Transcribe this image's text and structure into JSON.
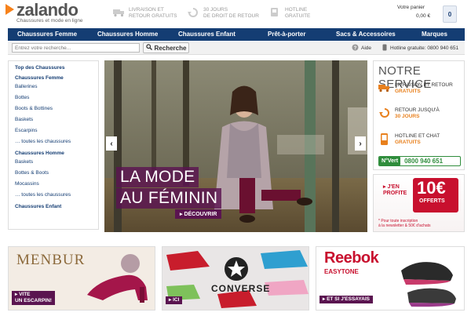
{
  "header": {
    "logo_word": "zalando",
    "logo_tagline": "Chaussures et mode en ligne",
    "usps": [
      {
        "icon": "truck-icon",
        "text_1": "LIVRAISON ET",
        "text_2": "RETOUR GRATUITS"
      },
      {
        "icon": "return-arrow-icon",
        "text_1": "30 JOURS",
        "text_2": "DE DROIT DE RETOUR"
      },
      {
        "icon": "phone-icon",
        "text_1": "HOTLINE",
        "text_2": "GRATUITE"
      }
    ],
    "cart": {
      "label": "Votre panier",
      "amount": "0,00 €",
      "count": "0"
    }
  },
  "nav": {
    "items": [
      "Chaussures Femme",
      "Chaussures Homme",
      "Chaussures Enfant",
      "Prêt-à-porter",
      "Sacs & Accessoires",
      "Marques"
    ]
  },
  "search": {
    "placeholder": "Entrez votre recherche...",
    "button": "Recherche",
    "help": "Aide",
    "hotline": "Hotline gratuite: 0800 940 651"
  },
  "sidebar": {
    "heading": "Top des Chaussures",
    "groups": [
      {
        "title": "Chaussures Femme",
        "links": [
          "Ballerines",
          "Bottes",
          "Boots & Bottines",
          "Baskets",
          "Escarpins",
          "… toutes les chaussures"
        ]
      },
      {
        "title": "Chaussures Homme",
        "links": [
          "Baskets",
          "Bottes & Boots",
          "Mocassins",
          "… toutes les chaussures"
        ]
      },
      {
        "title": "Chaussures Enfant",
        "links": []
      }
    ]
  },
  "hero": {
    "title_1": "LA MODE",
    "title_2": "AU FÉMININ",
    "cta": "▸ DÉCOUVRIR"
  },
  "service": {
    "title": "NOTRE SERVICE",
    "rows": [
      {
        "icon": "truck-icon",
        "text": "LIVRAISON ET RETOUR",
        "highlight": "GRATUITS"
      },
      {
        "icon": "return-arrow-icon",
        "text": "RETOUR JUSQU'À",
        "highlight": "30 JOURS"
      },
      {
        "icon": "mobile-phone-icon",
        "text": "HOTLINE ET CHAT",
        "highlight": "GRATUITS"
      }
    ],
    "nvert_tag": "N°Vert",
    "nvert_number": "0800 940 651"
  },
  "promo": {
    "prefix": "J'EN",
    "prefix_2": "PROFITE",
    "amount": "10€",
    "offered": "OFFERTS",
    "note_1": "* Pour toute inscription",
    "note_2": "à la newsletter & 50€ d'achats"
  },
  "banners": [
    {
      "brand": "MENBUR",
      "cta_1": "▸ VITE",
      "cta_2": "UN ESCARPIN!"
    },
    {
      "brand": "CONVERSE",
      "cta_1": "▸ ICI"
    },
    {
      "brand": "Reebok",
      "sub": "EASYTONE",
      "cta_1": "▸ ET SI J'ESSAYAIS"
    }
  ],
  "colors": {
    "brand_orange": "#f7821b",
    "nav_blue": "#143d73",
    "accent_purple": "#5a1450",
    "promo_red": "#c8102e"
  }
}
